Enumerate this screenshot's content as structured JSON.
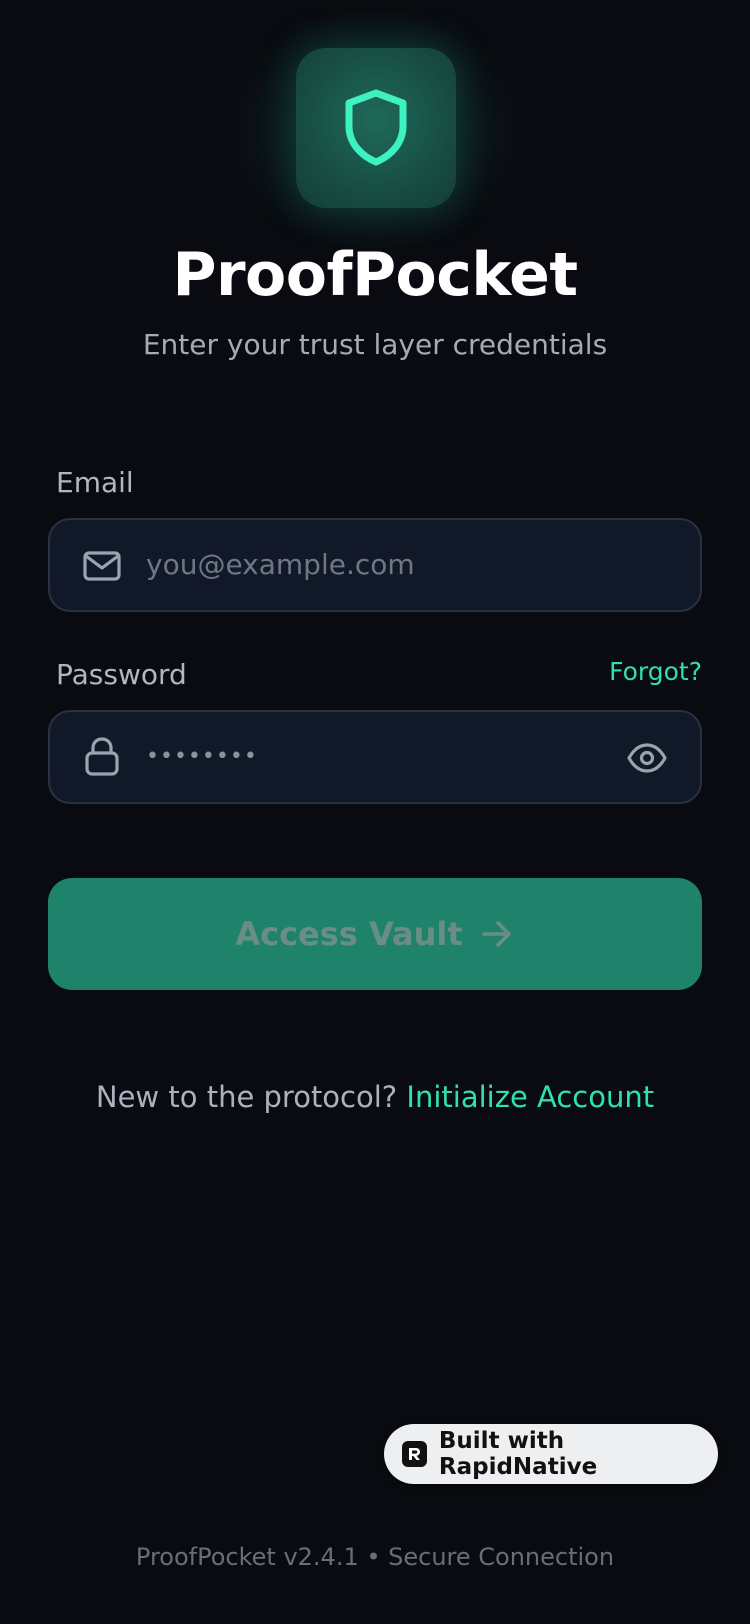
{
  "app": {
    "title": "ProofPocket",
    "subtitle": "Enter your trust layer credentials",
    "logo_icon": "shield-icon"
  },
  "form": {
    "email_label": "Email",
    "email_placeholder": "you@example.com",
    "email_icon": "mail-icon",
    "password_label": "Password",
    "password_value": "••••••••",
    "password_icon": "lock-icon",
    "password_toggle_icon": "eye-icon",
    "forgot_label": "Forgot?",
    "submit_label": "Access Vault",
    "submit_icon": "arrow-right-icon"
  },
  "signup": {
    "prompt": "New to the protocol?",
    "link_label": "Initialize Account"
  },
  "badge": {
    "label": "Built with RapidNative"
  },
  "footer": {
    "text": "ProofPocket v2.4.1 • Secure Connection"
  },
  "colors": {
    "background": "#090b10",
    "accent": "#2fe0b2",
    "button": "#1f836b",
    "field_bg": "#111827",
    "field_border": "#2a3242"
  }
}
